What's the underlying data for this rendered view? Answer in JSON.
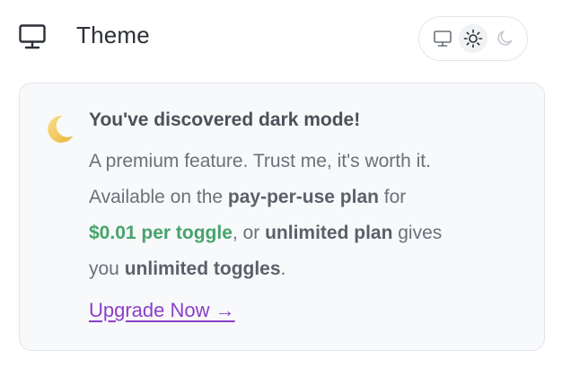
{
  "header": {
    "icon": "monitor-icon",
    "title": "Theme"
  },
  "theme_switch": {
    "options": [
      {
        "name": "system",
        "icon": "monitor-icon"
      },
      {
        "name": "light",
        "icon": "sun-icon",
        "selected": true
      },
      {
        "name": "dark",
        "icon": "moon-icon"
      }
    ]
  },
  "promo": {
    "icon": "crescent-moon-emoji",
    "heading": "You've discovered dark mode!",
    "line1": "A premium feature. Trust me, it's worth it.",
    "line2_pre": "Available on the ",
    "line2_plan": "pay-per-use plan",
    "line2_post": " for",
    "price": "$0.01 per toggle",
    "line3_post": ", or ",
    "unlimited_plan": "unlimited plan",
    "line3_end": " gives",
    "line4_pre": "you ",
    "unlimited_toggles": "unlimited toggles",
    "line4_end": ".",
    "cta": "Upgrade Now →"
  },
  "colors": {
    "price": "#45a36b",
    "link": "#8b3fc9",
    "card_bg": "#f8f9fb",
    "border": "#e3e5e9"
  }
}
